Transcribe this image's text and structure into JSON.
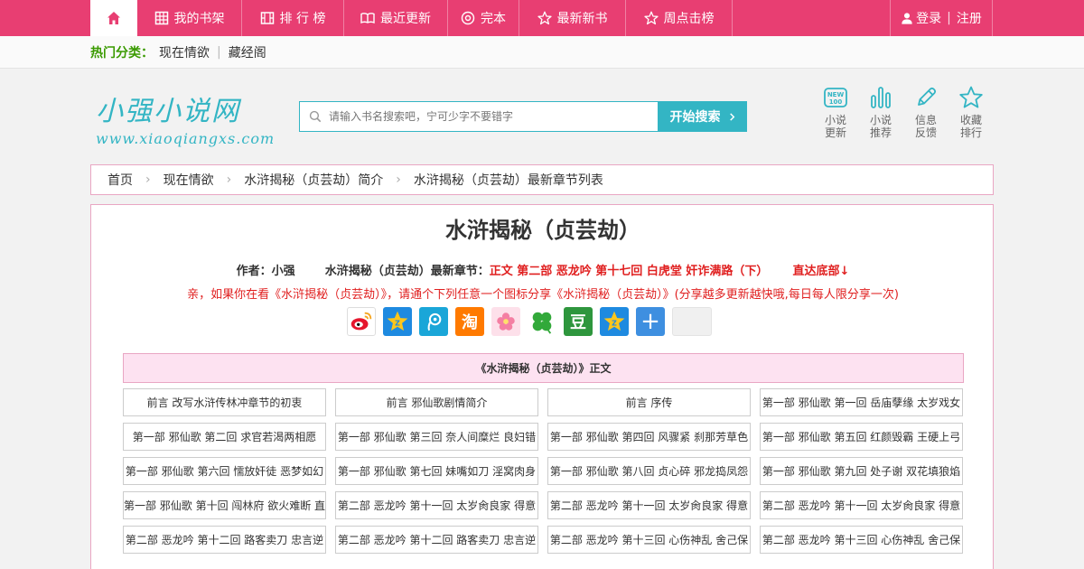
{
  "nav": {
    "items": [
      {
        "label": "我的书架",
        "icon": "bookshelf-icon"
      },
      {
        "label": "排 行 榜",
        "icon": "ranking-icon"
      },
      {
        "label": "最近更新",
        "icon": "open-book-icon"
      },
      {
        "label": "完本",
        "icon": "circle-dot-icon"
      },
      {
        "label": "最新新书",
        "icon": "star-icon"
      },
      {
        "label": "周点击榜",
        "icon": "star-icon"
      }
    ],
    "login": "登录",
    "separator": "|",
    "register": "注册"
  },
  "hot": {
    "label": "热门分类：",
    "links": [
      "现在情欲",
      "藏经阁"
    ]
  },
  "logo": {
    "cn": "小强小说网",
    "en": "www.xiaoqiangxs.com"
  },
  "search": {
    "placeholder": "请输入书名搜索吧，宁可少字不要错字",
    "button": "开始搜索"
  },
  "quick_links": [
    {
      "line1": "小说",
      "line2": "更新",
      "icon": "new-100-icon"
    },
    {
      "line1": "小说",
      "line2": "推荐",
      "icon": "bar-chart-icon"
    },
    {
      "line1": "信息",
      "line2": "反馈",
      "icon": "pencil-icon"
    },
    {
      "line1": "收藏",
      "line2": "排行",
      "icon": "star-outline-icon"
    }
  ],
  "breadcrumb": [
    "首页",
    "现在情欲",
    "水浒揭秘（贞芸劫）简介",
    "水浒揭秘（贞芸劫）最新章节列表"
  ],
  "book": {
    "title": "水浒揭秘（贞芸劫）",
    "author_label": "作者：小强",
    "latest_label": "水浒揭秘（贞芸劫）最新章节：",
    "latest_chapter": "正文 第二部 恶龙吟 第十七回 白虎堂 奸诈满路（下）",
    "bottom_link": "直达底部↓",
    "share_tip": "亲，如果你在看《水浒揭秘（贞芸劫）》，请通个下列任意一个图标分享《水浒揭秘（贞芸劫）》(分享越多更新越快哦,每日每人限分享一次)"
  },
  "share_icons": [
    {
      "name": "weibo-icon",
      "color": "#ffffff",
      "glyph": ""
    },
    {
      "name": "qzone-icon",
      "color": "#1e8ae0",
      "glyph": ""
    },
    {
      "name": "tencent-weibo-icon",
      "color": "#1aa6d8",
      "glyph": ""
    },
    {
      "name": "taobao-icon",
      "color": "#ff7a00",
      "glyph": "淘"
    },
    {
      "name": "flower-icon",
      "color": "#fde0ea",
      "glyph": ""
    },
    {
      "name": "clover-icon",
      "color": "#ffffff",
      "glyph": ""
    },
    {
      "name": "douban-icon",
      "color": "#2e963d",
      "glyph": "豆"
    },
    {
      "name": "qzone2-icon",
      "color": "#1e8ae0",
      "glyph": ""
    },
    {
      "name": "more-share-icon",
      "color": "#3e8fe0",
      "glyph": "+"
    },
    {
      "name": "empty-share-slot",
      "color": "#f0f0f0",
      "glyph": ""
    }
  ],
  "section_title": "《水浒揭秘（贞芸劫）》正文",
  "chapters": [
    "前言 改写水浒传林冲章节的初衷",
    "前言 邪仙歌剧情简介",
    "前言 序传",
    "第一部 邪仙歌 第一回 岳庙孽缘 太岁戏女",
    "第一部 邪仙歌 第二回 求官若渴两相愿",
    "第一部 邪仙歌 第三回 奈人间糜烂 良妇错",
    "第一部 邪仙歌 第四回 风骤紧 刹那芳草色",
    "第一部 邪仙歌 第五回 红颜毁霸 王硬上弓",
    "第一部 邪仙歌 第六回 懦放奸徒 恶梦如幻",
    "第一部 邪仙歌 第七回 妹嘴如刀 淫窝肉身",
    "第一部 邪仙歌 第八回 贞心碎 邪龙捣凤怨",
    "第一部 邪仙歌 第九回 处子谢 双花填狼焰",
    "第一部 邪仙歌 第十回 闯林府 欲火难断 直",
    "第二部 恶龙吟 第十一回 太岁肏良家 得意",
    "第二部 恶龙吟 第十一回 太岁肏良家 得意",
    "第二部 恶龙吟 第十一回 太岁肏良家 得意",
    "第二部 恶龙吟 第十二回 路客卖刀 忠言逆",
    "第二部 恶龙吟 第十二回 路客卖刀 忠言逆",
    "第二部 恶龙吟 第十三回 心伤神乱 舍己保",
    "第二部 恶龙吟 第十三回 心伤神乱 舍己保"
  ]
}
